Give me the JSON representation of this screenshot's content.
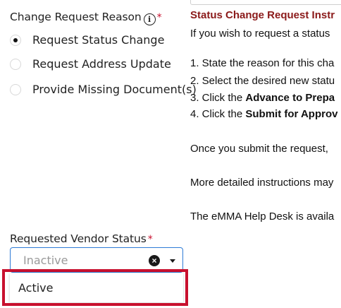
{
  "form": {
    "change_reason": {
      "label": "Change Request Reason",
      "info_icon": "i",
      "required_mark": "*",
      "options": [
        {
          "label": "Request Status Change",
          "checked": true
        },
        {
          "label": "Request Address Update",
          "checked": false
        },
        {
          "label": "Provide Missing Document(s)",
          "checked": false
        }
      ]
    },
    "vendor_status": {
      "label": "Requested Vendor Status",
      "required_mark": "*",
      "value": "Inactive",
      "clear_icon": "×",
      "dropdown_options": [
        "Active"
      ]
    }
  },
  "instructions": {
    "title": "Status Change Request Instr",
    "intro": "If you wish to request a status",
    "steps": [
      {
        "prefix": "1. State the reason for this cha",
        "bold": ""
      },
      {
        "prefix": "2. Select the desired new statu",
        "bold": ""
      },
      {
        "prefix": "3. Click the ",
        "bold": "Advance to Prepa"
      },
      {
        "prefix": "4. Click the ",
        "bold": "Submit for Approv"
      }
    ],
    "para1": "Once you submit the request,",
    "para2": "More detailed instructions may",
    "para3": "The eMMA Help Desk is availa"
  },
  "colors": {
    "required": "#c8102e",
    "title": "#8b1a1a",
    "focus_border": "#2e7bd6",
    "highlight": "#c8102e"
  }
}
